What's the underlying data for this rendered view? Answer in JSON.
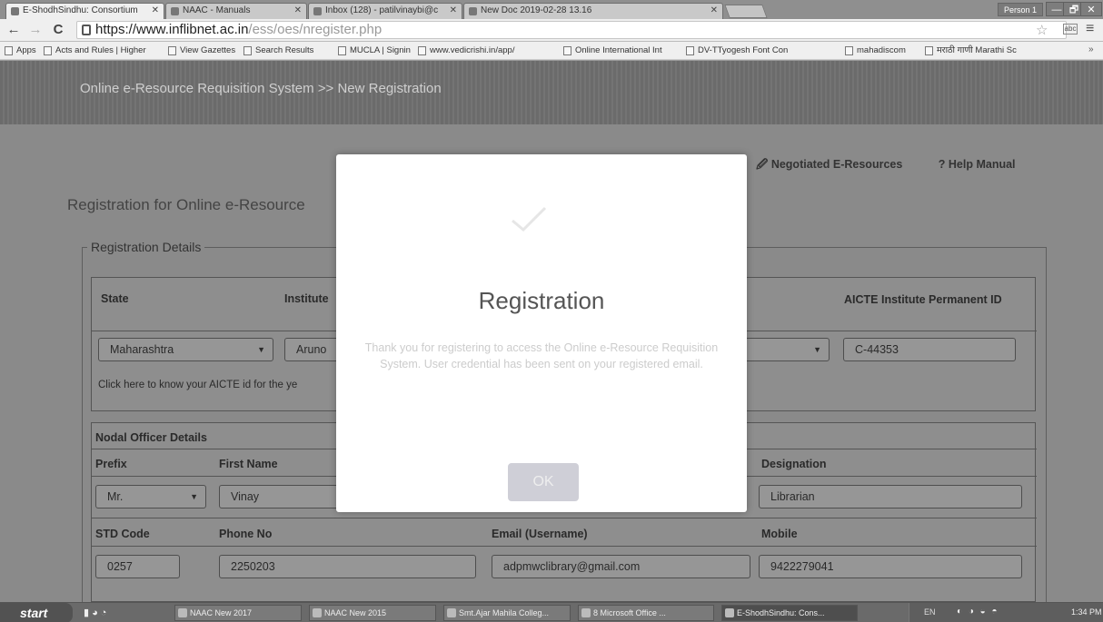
{
  "browser": {
    "tabs": [
      {
        "label": "E-ShodhSindhu: Consortium"
      },
      {
        "label": "NAAC - Manuals"
      },
      {
        "label": "Inbox (128) - patilvinaybi@c"
      },
      {
        "label": "New Doc 2019-02-28 13.16"
      }
    ],
    "person_label": "Person 1",
    "window_buttons": [
      "—",
      "🗗",
      "✕"
    ],
    "url_host": "https://www.inflibnet.ac.in",
    "url_path": "/ess/oes/nregister.php",
    "bookmarks": [
      "Apps",
      "Acts and Rules | Higher",
      "View Gazettes",
      "Search Results",
      "MUCLA | Signin",
      "www.vedicrishi.in/app/",
      "Online International Int",
      "DV-TTyogesh Font Con",
      "mahadiscom",
      "मराठी गाणी Marathi Sc"
    ]
  },
  "page": {
    "site_title": "Online e-Resource Requisition System >> New Registration",
    "links": {
      "negotiated": "Negotiated E-Resources",
      "help": "Help Manual"
    },
    "heading": "Registration for Online e-Resource",
    "legend": "Registration Details",
    "labels": {
      "state": "State",
      "institute": "Institute",
      "aicte_id": "AICTE Institute Permanent ID",
      "nodal_section": "Nodal Officer Details",
      "prefix": "Prefix",
      "first_name": "First Name",
      "designation": "Designation",
      "std_code": "STD Code",
      "phone_no": "Phone No",
      "email": "Email (Username)",
      "mobile": "Mobile"
    },
    "values": {
      "state": "Maharashtra",
      "institute": "Aruno",
      "aicte_id": "C-44353",
      "prefix": "Mr.",
      "first_name": "Vinay",
      "designation": "Librarian",
      "std_code": "0257",
      "phone_no": "2250203",
      "email": "adpmwclibrary@gmail.com",
      "mobile": "9422279041"
    },
    "aicte_hint": "Click here to know your AICTE id for the ye"
  },
  "modal": {
    "title": "Registration",
    "message": "Thank you for registering to access the Online e-Resource Requisition System. User credential has been sent on your registered email.",
    "ok_label": "OK"
  },
  "taskbar": {
    "start_label": "start",
    "tasks": [
      "NAAC New 2017",
      "NAAC New 2015",
      "Smt.Ajar Mahila Colleg...",
      "8 Microsoft Office ...",
      "E-ShodhSindhu: Cons..."
    ],
    "lang": "EN",
    "clock": "1:34 PM"
  }
}
